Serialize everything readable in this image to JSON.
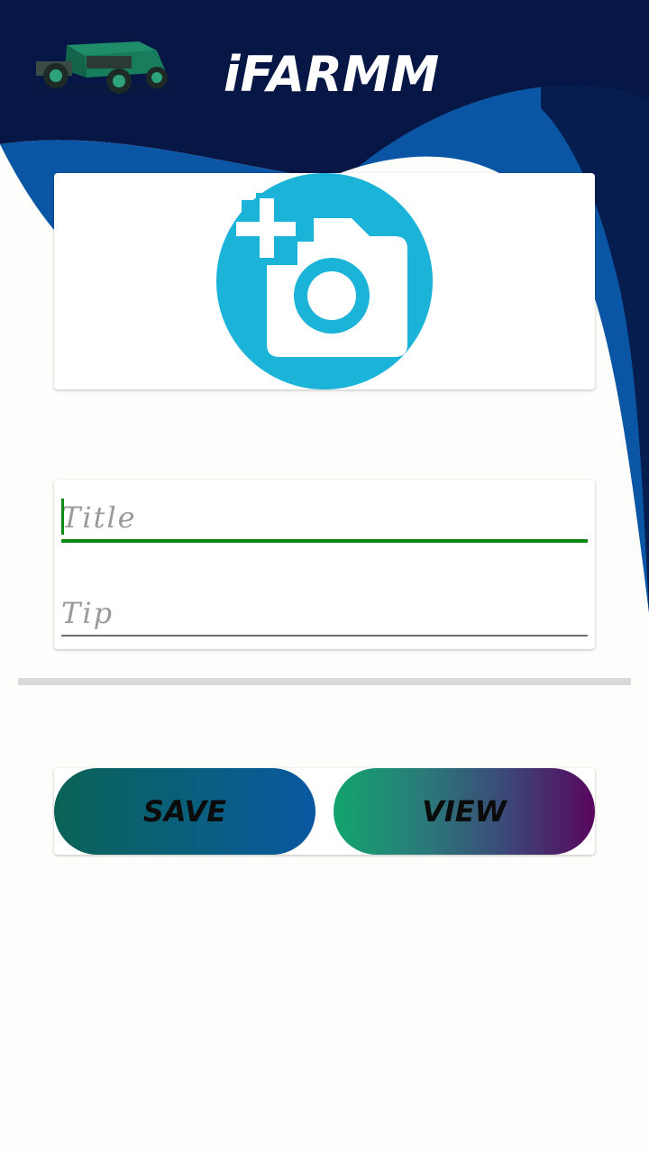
{
  "header": {
    "app_title": "iFARMM",
    "logo_icon": "tractor-icon"
  },
  "photo_picker": {
    "icon": "add-photo-icon",
    "icon_color": "#1cb3d9"
  },
  "form": {
    "title_field": {
      "placeholder": "Title",
      "value": ""
    },
    "tip_field": {
      "placeholder": "Tip",
      "value": ""
    },
    "accent_color": "#0a8a14"
  },
  "actions": {
    "save_label": "SAVE",
    "view_label": "VIEW"
  },
  "colors": {
    "header_navy": "#061746",
    "wave_blue": "#0b56a4",
    "background": "#fdfdfb"
  }
}
